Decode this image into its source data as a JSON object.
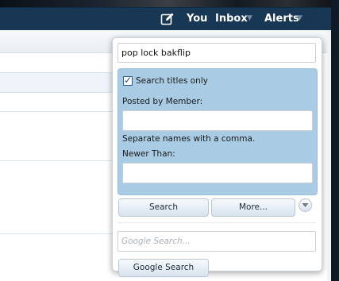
{
  "navbar": {
    "you": "You",
    "inbox": "Inbox",
    "alerts": "Alerts"
  },
  "search": {
    "query": "pop lock bakflip",
    "search_titles_only": "Search titles only",
    "search_titles_only_checked": true,
    "posted_by_label": "Posted by Member:",
    "posted_by_value": "",
    "separate_hint": "Separate names with a comma.",
    "newer_than_label": "Newer Than:",
    "newer_than_value": "",
    "search_button": "Search",
    "more_button": "More...",
    "google_placeholder": "Google Search...",
    "google_button": "Google Search"
  }
}
